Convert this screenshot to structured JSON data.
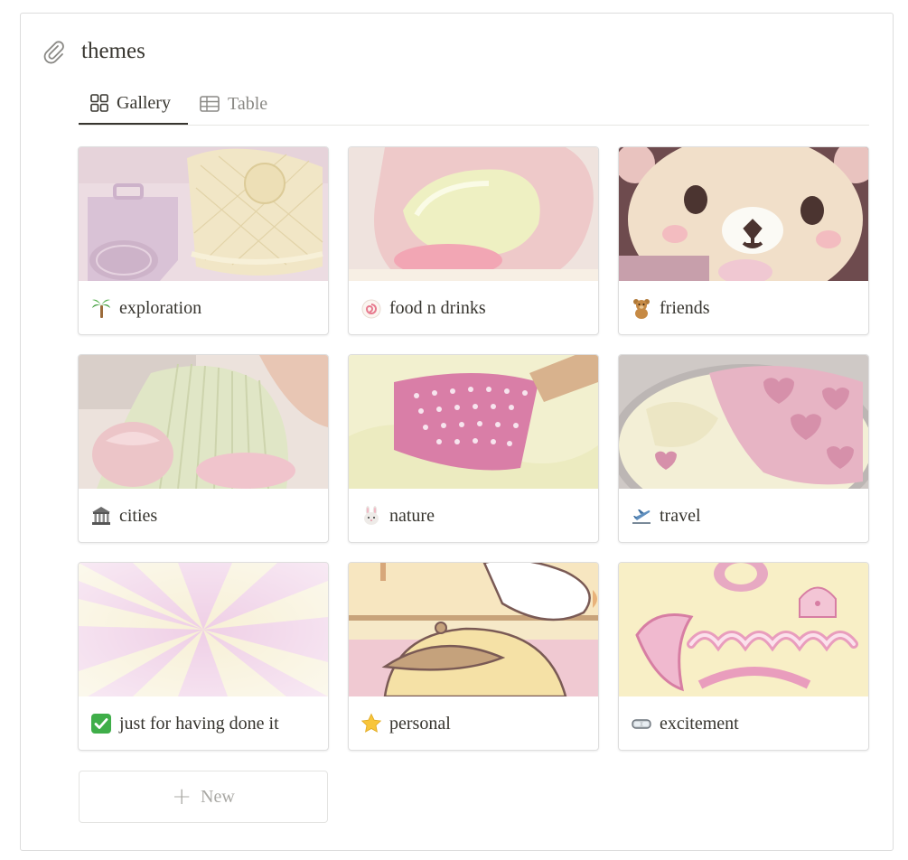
{
  "database": {
    "title": "themes",
    "icon": "paperclip-icon"
  },
  "tabs": [
    {
      "label": "Gallery",
      "icon": "gallery-grid-icon",
      "active": true
    },
    {
      "label": "Table",
      "icon": "table-icon",
      "active": false
    }
  ],
  "cards": [
    {
      "label": "exploration",
      "emoji": "palm-tree-icon"
    },
    {
      "label": "food n drinks",
      "emoji": "fish-cake-icon"
    },
    {
      "label": "friends",
      "emoji": "teddy-bear-icon"
    },
    {
      "label": "cities",
      "emoji": "classical-building-icon"
    },
    {
      "label": "nature",
      "emoji": "rabbit-face-icon"
    },
    {
      "label": "travel",
      "emoji": "airplane-departure-icon"
    },
    {
      "label": "just for having done it",
      "emoji": "check-mark-button-icon"
    },
    {
      "label": "personal",
      "emoji": "star-icon"
    },
    {
      "label": "excitement",
      "emoji": "goggles-icon"
    }
  ],
  "new_button": {
    "label": "New",
    "icon": "plus-icon"
  },
  "colors": {
    "text": "#37352f",
    "muted": "#8a8985",
    "border": "#dedede"
  }
}
